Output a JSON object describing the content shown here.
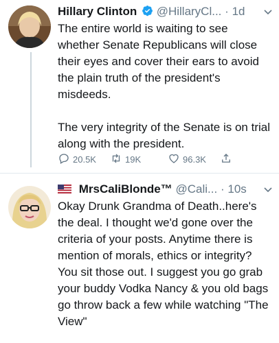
{
  "tweets": [
    {
      "author_name": "Hillary Clinton",
      "handle": "@HillaryCl...",
      "separator": "·",
      "time": "1d",
      "verified": true,
      "paragraphs": [
        "The entire world is waiting to see whether Senate Republicans will close their eyes and cover their ears to avoid the plain truth of the president's misdeeds.",
        "The very integrity of the Senate is on trial along with the president."
      ],
      "stats": {
        "replies": "20.5K",
        "retweets": "19K",
        "likes": "96.3K"
      }
    },
    {
      "author_name": "MrsCaliBlondeTM",
      "author_name_display": "MrsCaliBlonde™",
      "handle": "@Cali...",
      "separator": "·",
      "time": "10s",
      "flag_icon": "us-flag-icon",
      "paragraphs": [
        "Okay Drunk Grandma of Death..here's the deal. I thought we'd gone over the criteria of your posts. Anytime there is mention of morals, ethics or integrity? You sit those out. I suggest you go grab your buddy Vodka Nancy & you old bags go throw back a few while watching \"The View\""
      ]
    }
  ],
  "colors": {
    "verified": "#1da1f2",
    "muted": "#657786",
    "text": "#14171a"
  }
}
